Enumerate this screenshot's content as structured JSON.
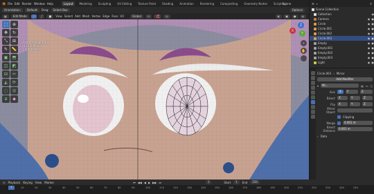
{
  "topbar": {
    "menus": [
      "File",
      "Edit",
      "Render",
      "Window",
      "Help"
    ],
    "workspaces": [
      "Layout",
      "Modeling",
      "Sculpting",
      "UV Editing",
      "Texture Paint",
      "Shading",
      "Animation",
      "Rendering",
      "Compositing",
      "Geometry Nodes",
      "Scripting"
    ],
    "active_workspace": "Layout",
    "scene": "Scene",
    "view_layer": "ViewLayer"
  },
  "viewport_header": {
    "editor_type": "Edit Mode",
    "menus": [
      "View",
      "Select",
      "Add",
      "Mesh",
      "Vertex",
      "Edge",
      "Face",
      "UV"
    ],
    "transform_orientation": "Global",
    "pivot": "Global"
  },
  "tool_settings": {
    "orientation_label": "Orientation:",
    "orientation_value": "Default",
    "drag_label": "Drag:",
    "drag_value": "Select Box",
    "options_label": "Options"
  },
  "viewport_info": {
    "line1": "Front Orthographic",
    "line2": "(1) Circle.003",
    "line3": "Centimeters"
  },
  "toolbar": {
    "tools": [
      "select-box",
      "cursor",
      "move",
      "rotate",
      "scale",
      "transform",
      "annotate",
      "measure",
      "add-cube",
      "extrude",
      "inset",
      "bevel",
      "loop-cut",
      "knife",
      "poly-build",
      "spin",
      "smooth",
      "shrink",
      "shear",
      "rip"
    ]
  },
  "outliner": {
    "title": "Scene Collection",
    "items": [
      {
        "name": "Collection",
        "color": "#d8d8d8",
        "selected": false
      },
      {
        "name": "Camera",
        "color": "#c47f3a",
        "selected": false
      },
      {
        "name": "Circle",
        "color": "#e09a4a",
        "selected": false
      },
      {
        "name": "Circle.001",
        "color": "#e09a4a",
        "selected": false
      },
      {
        "name": "Circle.002",
        "color": "#e09a4a",
        "selected": false
      },
      {
        "name": "Circle.003",
        "color": "#e09a4a",
        "selected": true
      },
      {
        "name": "Empty",
        "color": "#a0a0a0",
        "selected": false
      },
      {
        "name": "Empty.001",
        "color": "#a0a0a0",
        "selected": false
      },
      {
        "name": "Empty.002",
        "color": "#a0a0a0",
        "selected": false
      },
      {
        "name": "Empty.003",
        "color": "#a0a0a0",
        "selected": false
      },
      {
        "name": "Light",
        "color": "#d8c04a",
        "selected": false
      }
    ]
  },
  "properties": {
    "object_name": "Circle.003",
    "modifier_type": "Mirror",
    "add_modifier": "Add Modifier",
    "modifier_name": "Mi...",
    "axis_label": "Axis",
    "axes": [
      "X",
      "Y",
      "Z"
    ],
    "bisect_label": "Bisect",
    "flip_label": "Flip",
    "mirror_object_label": "Mirror Object",
    "clipping_label": "Clipping",
    "merge_label": "Merge",
    "merge_value": "0.001 m",
    "bisect_distance_label": "Bisect Distance",
    "bisect_distance_value": "0.001 m",
    "data_label": "Data"
  },
  "timeline": {
    "menus": [
      "Playback",
      "Keying",
      "View",
      "Marker"
    ],
    "current_frame": "1",
    "start_label": "Start",
    "start_value": "1",
    "end_label": "End",
    "end_value": "250",
    "ticks": [
      "10",
      "20",
      "30",
      "40",
      "50",
      "60",
      "70",
      "80",
      "90",
      "100",
      "110",
      "120",
      "130",
      "140",
      "150",
      "160",
      "170",
      "180",
      "190",
      "200",
      "210",
      "220",
      "230",
      "240",
      "250"
    ]
  },
  "colors": {
    "accent": "#4772b3",
    "panel": "#2b2b2b",
    "selected_row": "#334d80"
  }
}
